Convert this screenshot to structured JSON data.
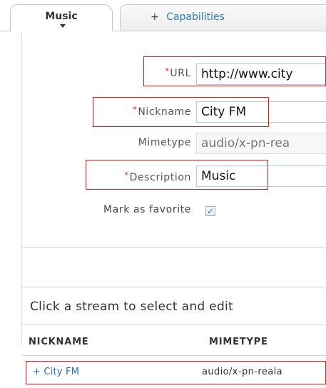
{
  "tabs": {
    "music_label": "Music",
    "capabilities_plus": "+",
    "capabilities_label": "Capabilities"
  },
  "form": {
    "required_marker": "*",
    "url": {
      "label": "URL",
      "value": "http://www.city"
    },
    "nickname": {
      "label": "Nickname",
      "value": "City FM"
    },
    "mimetype": {
      "label": "Mimetype",
      "value": "audio/x-pn-rea"
    },
    "description": {
      "label": "Description",
      "value": "Music"
    },
    "favorite": {
      "label": "Mark as favorite",
      "checked": true,
      "check_glyph": "✓"
    }
  },
  "list": {
    "title": "Click a stream to select and edit",
    "columns": [
      "NICKNAME",
      "MIMETYPE"
    ],
    "rows": [
      {
        "nickname": "+ City FM",
        "mimetype": "audio/x-pn-reala"
      }
    ]
  },
  "colors": {
    "highlight": "#e01a1a",
    "link": "#2a6fb0",
    "required": "#d01818"
  }
}
